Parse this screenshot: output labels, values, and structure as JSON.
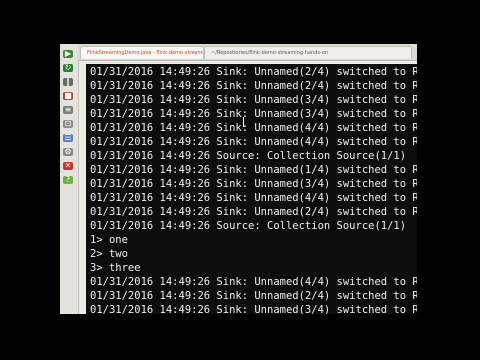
{
  "tabs": [
    "FlinkStreamingDemo.java - flink-demo-streaming-hands-on",
    "~/Repositories/flink-demo-streaming-hands-on"
  ],
  "console": {
    "lines": [
      "01/31/2016 14:49:26 Sink: Unnamed(2/4) switched to R",
      "01/31/2016 14:49:26 Sink: Unnamed(2/4) switched to R",
      "01/31/2016 14:49:26 Sink: Unnamed(3/4) switched to R",
      "01/31/2016 14:49:26 Sink: Unnamed(3/4) switched to R",
      "01/31/2016 14:49:26 Sink: Unnamed(4/4) switched to R",
      "01/31/2016 14:49:26 Sink: Unnamed(4/4) switched to R",
      "01/31/2016 14:49:26 Source: Collection Source(1/1)",
      "01/31/2016 14:49:26 Sink: Unnamed(1/4) switched to R",
      "01/31/2016 14:49:26 Sink: Unnamed(3/4) switched to R",
      "01/31/2016 14:49:26 Sink: Unnamed(4/4) switched to R",
      "01/31/2016 14:49:26 Sink: Unnamed(2/4) switched to R",
      "01/31/2016 14:49:26 Source: Collection Source(1/1)",
      "1> one",
      "2> two",
      "3> three",
      "01/31/2016 14:49:26 Sink: Unnamed(4/4) switched to R",
      "01/31/2016 14:49:26 Sink: Unnamed(2/4) switched to R",
      "01/31/2016 14:49:26 Sink: Unnamed(3/4) switched to R"
    ]
  },
  "colors": {
    "console_bg": "#0d0d0d",
    "console_text": "#efefef",
    "ide_chrome": "#ecebe6",
    "active_tab_text": "#d04622"
  },
  "toolbar_icons": [
    "run-icon",
    "stop-icon",
    "pause-icon",
    "rerun-icon",
    "step-icon",
    "restore-icon",
    "dump-icon",
    "settings-icon",
    "close-icon",
    "help-icon"
  ]
}
